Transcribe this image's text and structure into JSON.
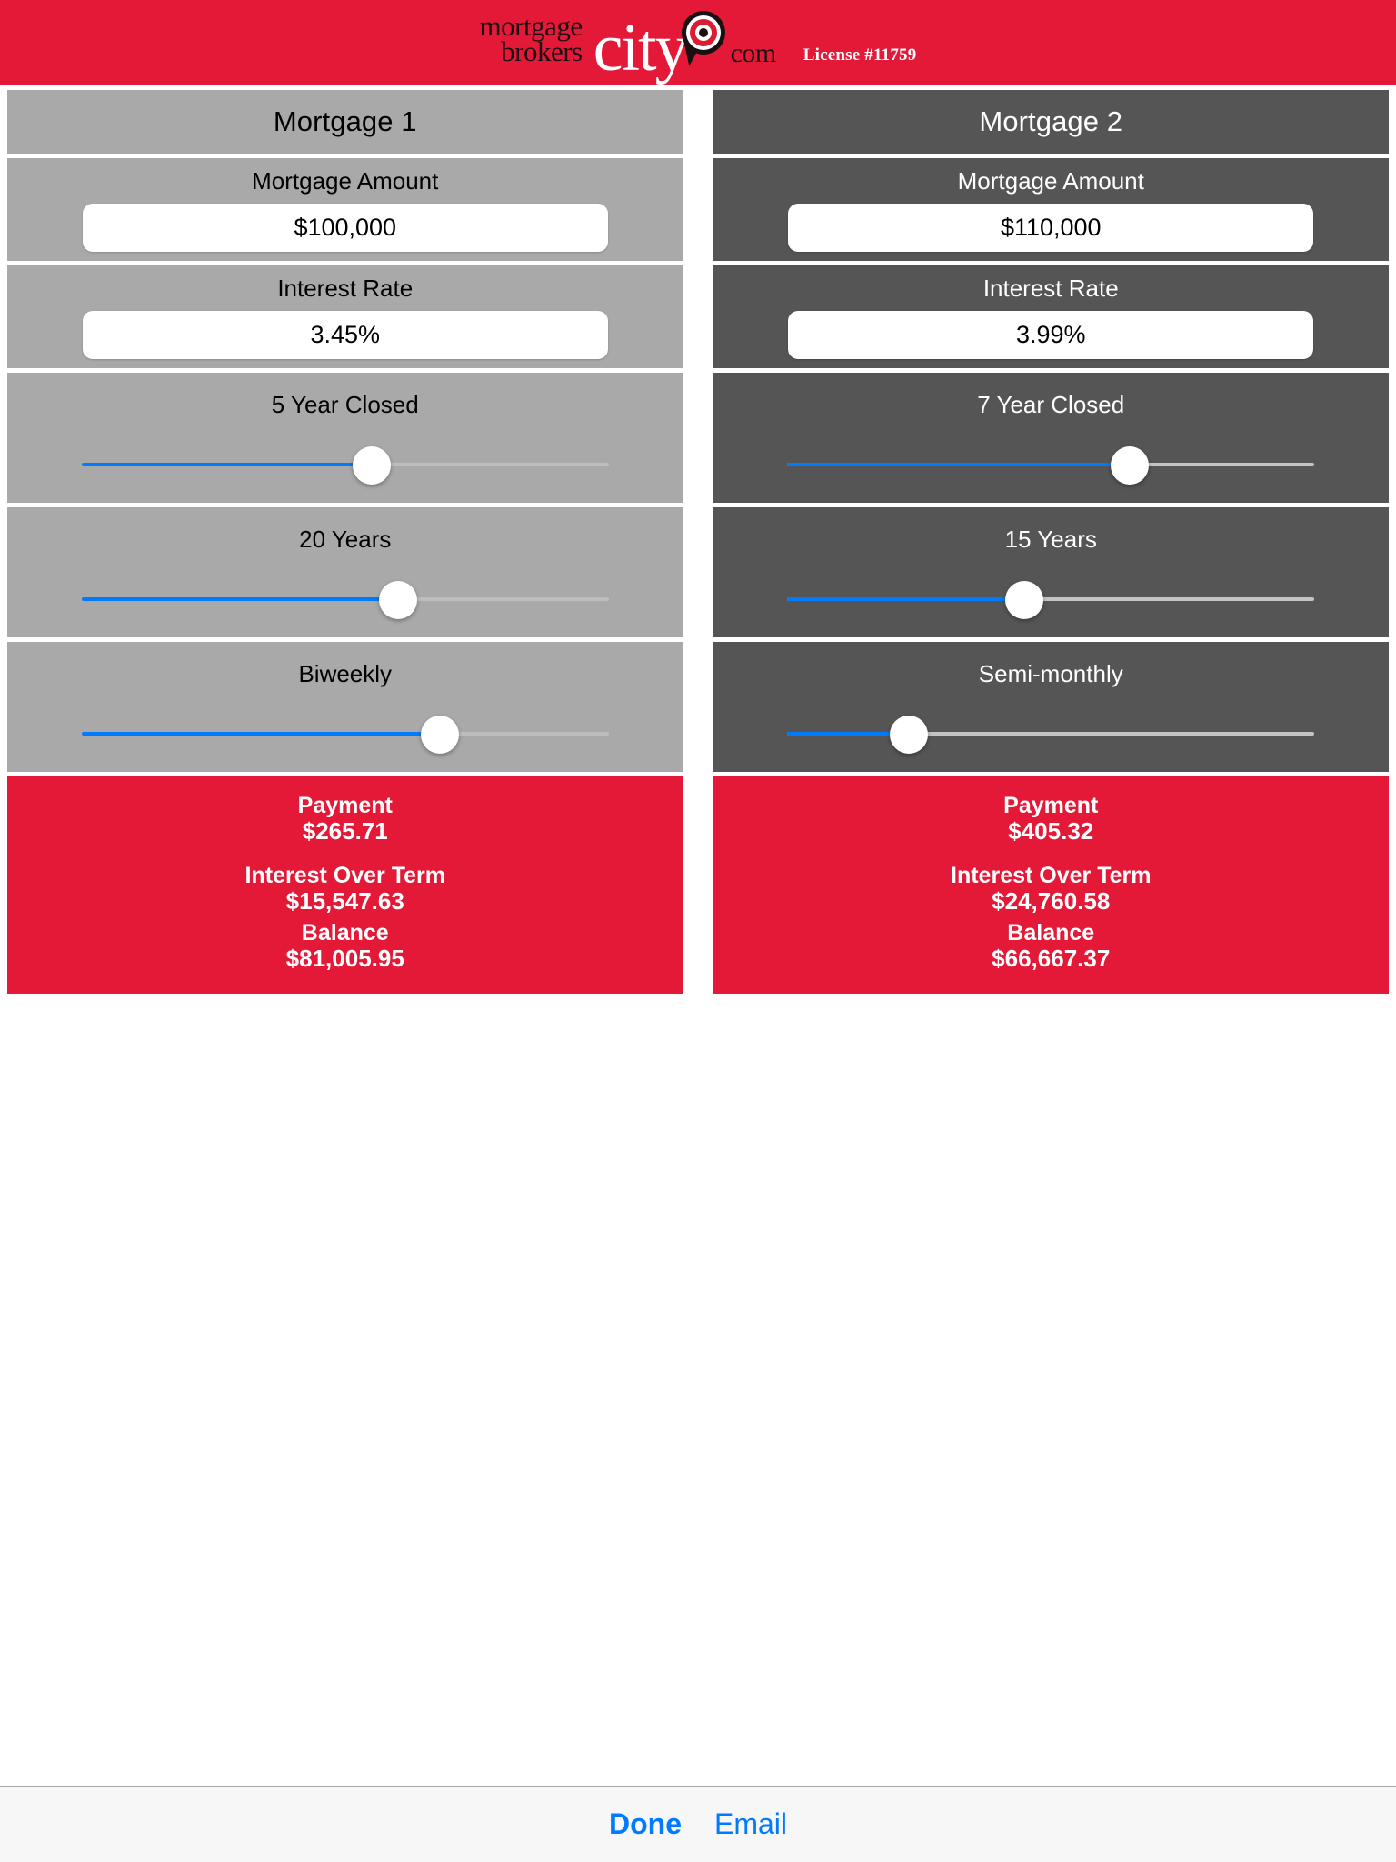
{
  "header": {
    "brand_line1": "mortgage",
    "brand_line2": "brokers",
    "brand_city": "city",
    "brand_com": "com",
    "license": "License #11759",
    "brand_red": "#e31937"
  },
  "colors": {
    "accent_blue": "#007aff",
    "brand_red": "#e31937",
    "panel_light": "#a9a9a9",
    "panel_dark": "#555555"
  },
  "mortgages": [
    {
      "title": "Mortgage 1",
      "theme": "light",
      "amount_label": "Mortgage Amount",
      "amount_value": "$100,000",
      "amount_placeholder": "$100,000",
      "rate_label": "Interest Rate",
      "rate_value": "3.45%",
      "rate_placeholder": "3.45%",
      "term_label": "5 Year Closed",
      "term_percent": 55,
      "amortization_label": "20 Years",
      "amortization_percent": 60,
      "frequency_label": "Biweekly",
      "frequency_percent": 68,
      "payment_label": "Payment",
      "payment_value": "$265.71",
      "interest_label": "Interest Over Term",
      "interest_value": "$15,547.63",
      "balance_label": "Balance",
      "balance_value": "$81,005.95"
    },
    {
      "title": "Mortgage 2",
      "theme": "dark",
      "amount_label": "Mortgage Amount",
      "amount_value": "$110,000",
      "amount_placeholder": "$110,000",
      "rate_label": "Interest Rate",
      "rate_value": "3.99%",
      "rate_placeholder": "3.99%",
      "term_label": "7 Year Closed",
      "term_percent": 65,
      "amortization_label": "15 Years",
      "amortization_percent": 45,
      "frequency_label": "Semi-monthly",
      "frequency_percent": 23,
      "payment_label": "Payment",
      "payment_value": "$405.32",
      "interest_label": "Interest Over Term",
      "interest_value": "$24,760.58",
      "balance_label": "Balance",
      "balance_value": "$66,667.37"
    }
  ],
  "toolbar": {
    "done_label": "Done",
    "email_label": "Email"
  }
}
